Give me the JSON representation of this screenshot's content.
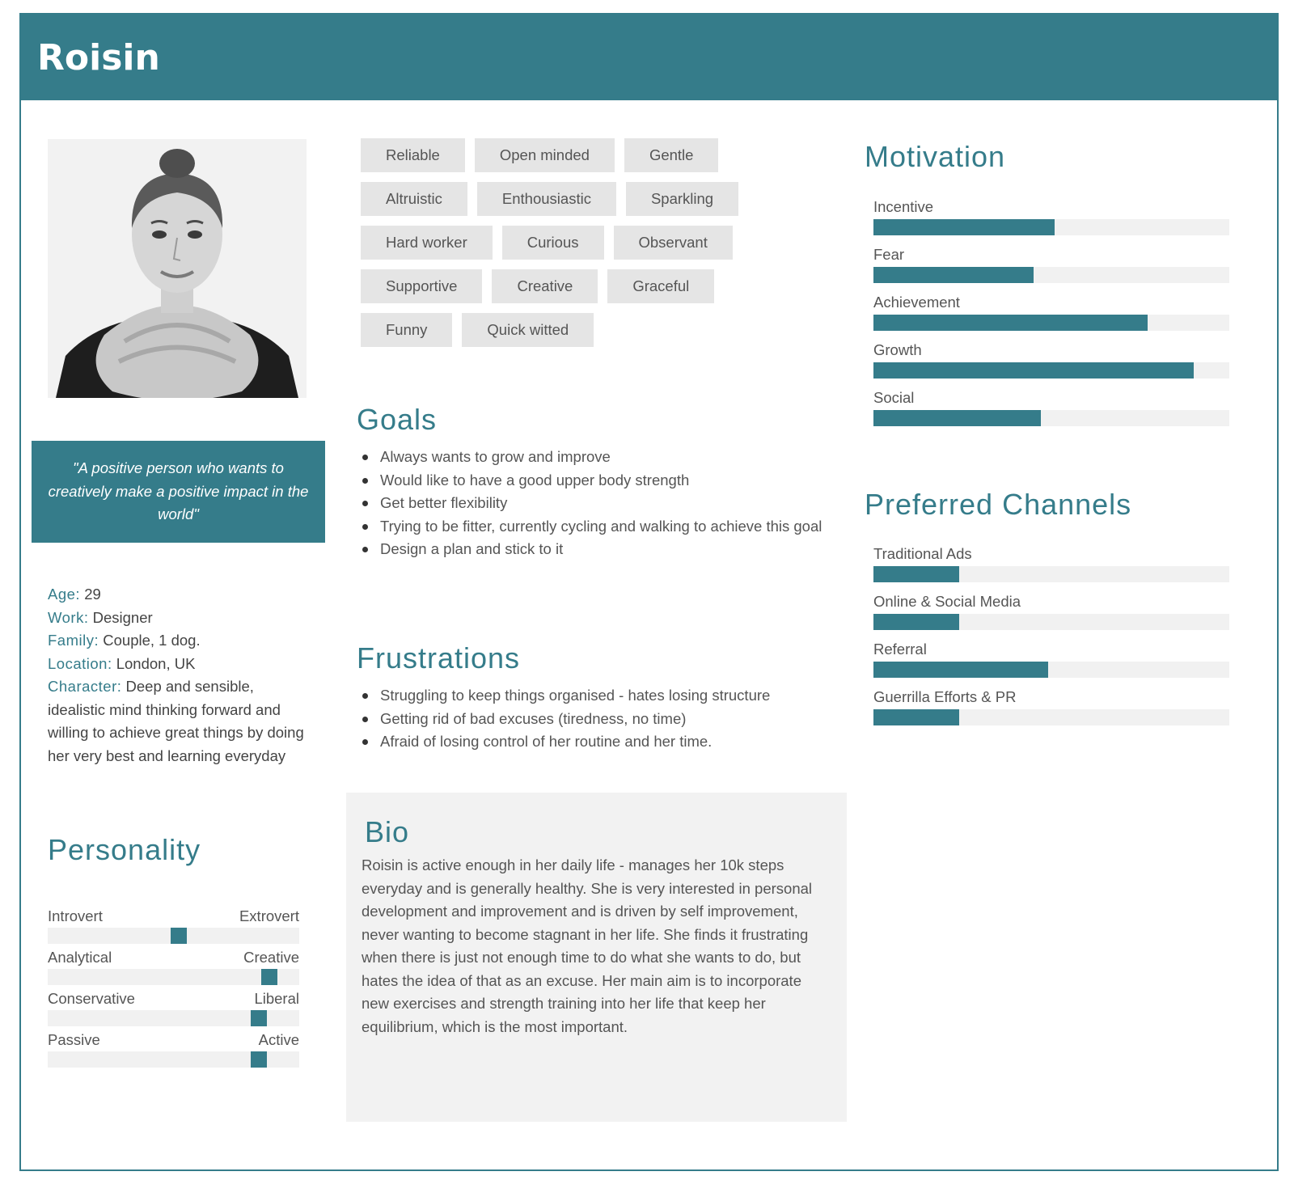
{
  "persona": {
    "name": "Roisin",
    "quote": "\"A positive person who wants to creatively make a positive impact in the world\"",
    "facts": [
      {
        "key": "Age:",
        "value": " 29"
      },
      {
        "key": "Work:",
        "value": " Designer"
      },
      {
        "key": "Family:",
        "value": " Couple, 1 dog."
      },
      {
        "key": "Location:",
        "value": " London, UK"
      },
      {
        "key": "Character:",
        "value": " Deep and sensible, idealistic mind thinking forward and willing to achieve great things by doing her very best and learning everyday"
      }
    ]
  },
  "personality": {
    "title": "Personality",
    "items": [
      {
        "left": "Introvert",
        "right": "Extrovert",
        "value": 0.52
      },
      {
        "left": "Analytical",
        "right": "Creative",
        "value": 0.88
      },
      {
        "left": "Conservative",
        "right": "Liberal",
        "value": 0.84
      },
      {
        "left": "Passive",
        "right": "Active",
        "value": 0.84
      }
    ]
  },
  "traits": [
    [
      "Reliable",
      "Open minded",
      "Gentle"
    ],
    [
      "Altruistic",
      "Enthousiastic",
      "Sparkling"
    ],
    [
      "Hard worker",
      "Curious",
      "Observant"
    ],
    [
      "Supportive",
      "Creative",
      "Graceful"
    ],
    [
      "Funny",
      "Quick witted"
    ]
  ],
  "goals": {
    "title": "Goals",
    "items": [
      "Always wants to grow and improve",
      "Would like to have a good upper body strength",
      "Get better flexibility",
      "Trying to be fitter, currently cycling and walking to achieve this goal",
      "Design a plan and stick to it"
    ]
  },
  "frustrations": {
    "title": "Frustrations",
    "items": [
      "Struggling to keep things organised - hates losing structure",
      "Getting rid of bad excuses (tiredness, no time)",
      "Afraid of losing control of her routine and her time."
    ]
  },
  "bio": {
    "title": "Bio",
    "text": "Roisin is active enough in her daily life - manages her 10k steps everyday and is generally healthy. She is very interested in personal development and improvement and is driven by self improvement, never wanting to become stagnant in her life. She finds it frustrating when there is just not enough time to do what she wants to do, but hates the idea of that as an excuse. Her main aim is to incorporate new exercises and strength training into her life that keep her equilibrium, which is the most important."
  },
  "motivation": {
    "title": "Motivation",
    "items": [
      {
        "label": "Incentive",
        "value": 0.51
      },
      {
        "label": "Fear",
        "value": 0.45
      },
      {
        "label": "Achievement",
        "value": 0.77
      },
      {
        "label": "Growth",
        "value": 0.9
      },
      {
        "label": "Social",
        "value": 0.47
      }
    ]
  },
  "channels": {
    "title": "Preferred Channels",
    "items": [
      {
        "label": "Traditional Ads",
        "value": 0.24
      },
      {
        "label": "Online & Social Media",
        "value": 0.24
      },
      {
        "label": "Referral",
        "value": 0.49
      },
      {
        "label": "Guerrilla Efforts & PR",
        "value": 0.24
      }
    ]
  },
  "colors": {
    "accent": "#357c8a",
    "tag_bg": "#e5e5e5",
    "track": "#f1f1f1"
  }
}
